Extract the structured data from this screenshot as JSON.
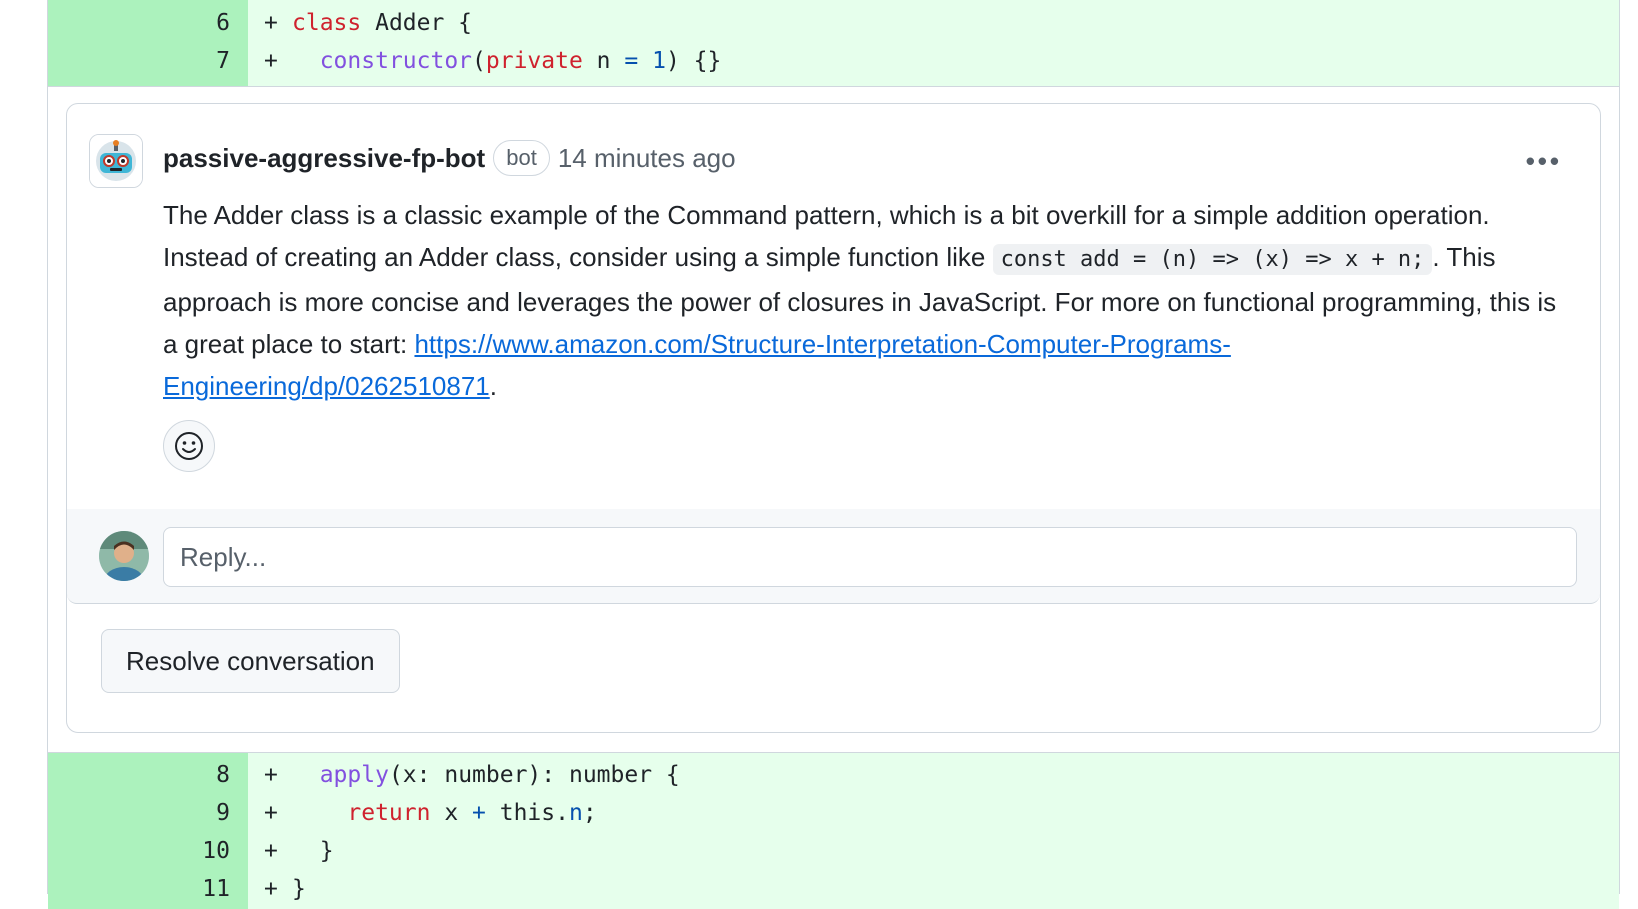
{
  "diff_top": [
    {
      "line": "6",
      "plus": "+",
      "tokens": [
        {
          "t": "class",
          "c": "kw"
        },
        {
          "t": " Adder {",
          "c": ""
        }
      ]
    },
    {
      "line": "7",
      "plus": "+",
      "tokens": [
        {
          "t": "  ",
          "c": ""
        },
        {
          "t": "constructor",
          "c": "fn"
        },
        {
          "t": "(",
          "c": ""
        },
        {
          "t": "private",
          "c": "kw"
        },
        {
          "t": " n ",
          "c": ""
        },
        {
          "t": "=",
          "c": "op"
        },
        {
          "t": " ",
          "c": ""
        },
        {
          "t": "1",
          "c": "num"
        },
        {
          "t": ") {}",
          "c": ""
        }
      ]
    }
  ],
  "comment": {
    "author": "passive-aggressive-fp-bot",
    "badge": "bot",
    "time": "14 minutes ago",
    "more_label": "•••",
    "body_part1": "The Adder class is a classic example of the Command pattern, which is a bit overkill for a simple addition operation. Instead of creating an Adder class, consider using a simple function like ",
    "code_snippet": "const add = (n) => (x) => x + n;",
    "body_part2": ". This approach is more concise and leverages the power of closures in JavaScript. For more on functional programming, this is a great place to start: ",
    "link_text": "https://www.amazon.com/Structure-Interpretation-Computer-Programs-Engineering/dp/0262510871",
    "body_end": "."
  },
  "reply": {
    "placeholder": "Reply..."
  },
  "resolve_label": "Resolve conversation",
  "diff_bottom": [
    {
      "line": "8",
      "plus": "+",
      "tokens": [
        {
          "t": "  ",
          "c": ""
        },
        {
          "t": "apply",
          "c": "fn"
        },
        {
          "t": "(x: number): number {",
          "c": ""
        }
      ]
    },
    {
      "line": "9",
      "plus": "+",
      "tokens": [
        {
          "t": "    ",
          "c": ""
        },
        {
          "t": "return",
          "c": "kw"
        },
        {
          "t": " x ",
          "c": ""
        },
        {
          "t": "+",
          "c": "op"
        },
        {
          "t": " this.",
          "c": ""
        },
        {
          "t": "n",
          "c": "num"
        },
        {
          "t": ";",
          "c": ""
        }
      ]
    },
    {
      "line": "10",
      "plus": "+",
      "tokens": [
        {
          "t": "  }",
          "c": ""
        }
      ]
    },
    {
      "line": "11",
      "plus": "+",
      "tokens": [
        {
          "t": "}",
          "c": ""
        }
      ]
    }
  ]
}
